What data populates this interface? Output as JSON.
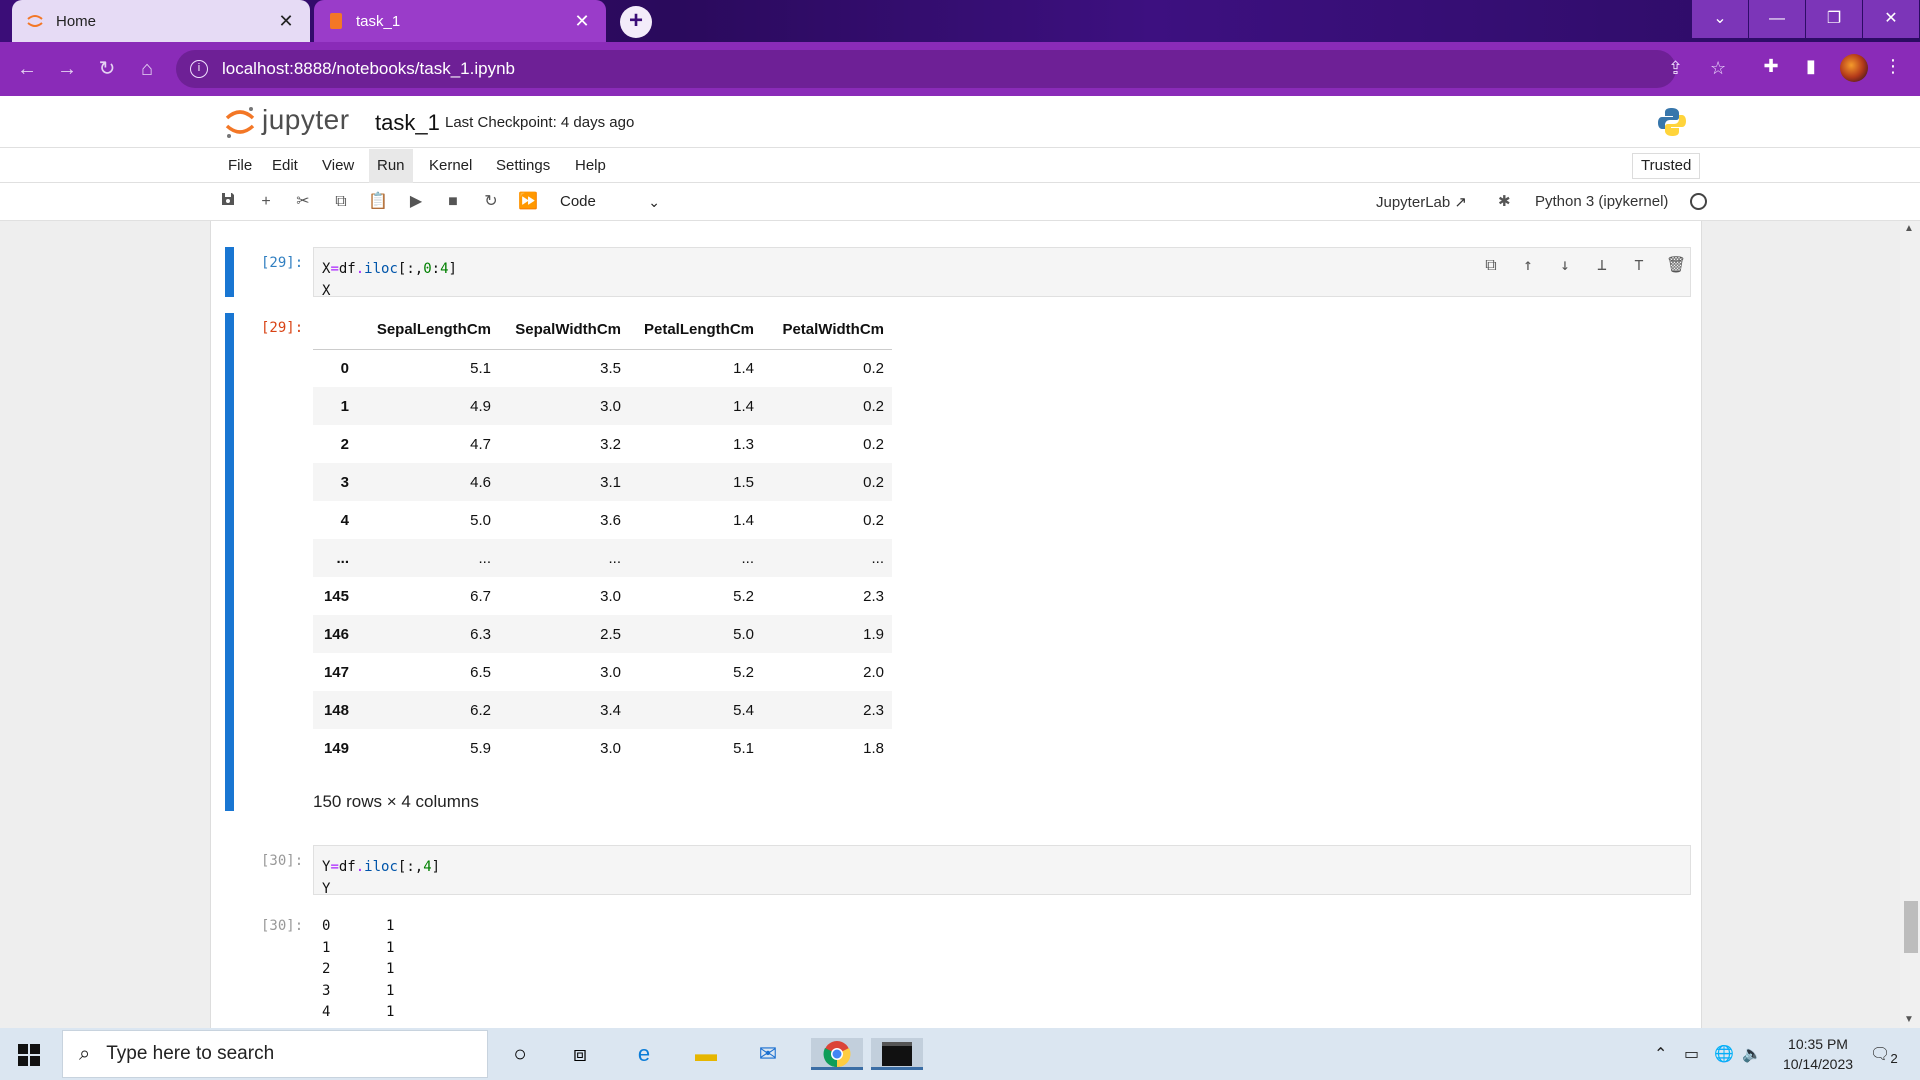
{
  "browser": {
    "tabs": [
      {
        "label": "Home",
        "icon": "jupyter-icon",
        "close": "✕"
      },
      {
        "label": "task_1",
        "icon": "notebook-icon",
        "close": "✕"
      }
    ],
    "new_tab": "+",
    "url": "localhost:8888/notebooks/task_1.ipynb"
  },
  "jupyter": {
    "brand": "jupyter",
    "notebook_name": "task_1",
    "checkpoint": "Last Checkpoint: 4 days ago",
    "menu": [
      "File",
      "Edit",
      "View",
      "Run",
      "Kernel",
      "Settings",
      "Help"
    ],
    "menu_open": "Run",
    "trusted": "Trusted",
    "cell_type": "Code",
    "jupyterlab_link": "JupyterLab",
    "kernel": "Python 3 (ipykernel)"
  },
  "cells": {
    "c29": {
      "in_prompt": "[29]:",
      "out_prompt": "[29]:",
      "code_line1_a": "X",
      "code_line1_b": "=",
      "code_line1_c": "df",
      "code_line1_d": ".",
      "code_line1_e": "iloc",
      "code_line1_f": "[:,",
      "code_line1_g": "0",
      "code_line1_h": ":",
      "code_line1_i": "4",
      "code_line1_j": "]",
      "code_line2": "X"
    },
    "c30": {
      "in_prompt": "[30]:",
      "out_prompt": "[30]:",
      "code_line1_a": "Y",
      "code_line1_b": "=",
      "code_line1_c": "df",
      "code_line1_d": ".",
      "code_line1_e": "iloc",
      "code_line1_f": "[:,",
      "code_line1_g": "4",
      "code_line1_h": "]",
      "code_line2": "Y"
    }
  },
  "dataframe": {
    "columns": [
      "",
      "SepalLengthCm",
      "SepalWidthCm",
      "PetalLengthCm",
      "PetalWidthCm"
    ],
    "rows": [
      [
        "0",
        "5.1",
        "3.5",
        "1.4",
        "0.2"
      ],
      [
        "1",
        "4.9",
        "3.0",
        "1.4",
        "0.2"
      ],
      [
        "2",
        "4.7",
        "3.2",
        "1.3",
        "0.2"
      ],
      [
        "3",
        "4.6",
        "3.1",
        "1.5",
        "0.2"
      ],
      [
        "4",
        "5.0",
        "3.6",
        "1.4",
        "0.2"
      ],
      [
        "...",
        "...",
        "...",
        "...",
        "..."
      ],
      [
        "145",
        "6.7",
        "3.0",
        "5.2",
        "2.3"
      ],
      [
        "146",
        "6.3",
        "2.5",
        "5.0",
        "1.9"
      ],
      [
        "147",
        "6.5",
        "3.0",
        "5.2",
        "2.0"
      ],
      [
        "148",
        "6.2",
        "3.4",
        "5.4",
        "2.3"
      ],
      [
        "149",
        "5.9",
        "3.0",
        "5.1",
        "1.8"
      ]
    ],
    "shape": "150 rows × 4 columns"
  },
  "series_output": [
    [
      "0",
      "1"
    ],
    [
      "1",
      "1"
    ],
    [
      "2",
      "1"
    ],
    [
      "3",
      "1"
    ],
    [
      "4",
      "1"
    ]
  ],
  "taskbar": {
    "search_placeholder": "Type here to search",
    "time": "10:35 PM",
    "date": "10/14/2023",
    "notifications": "2"
  },
  "colors": {
    "browser_frame": "#8a2bb8",
    "selected_cell": "#1976d2",
    "jupyter_orange": "#f37726"
  }
}
